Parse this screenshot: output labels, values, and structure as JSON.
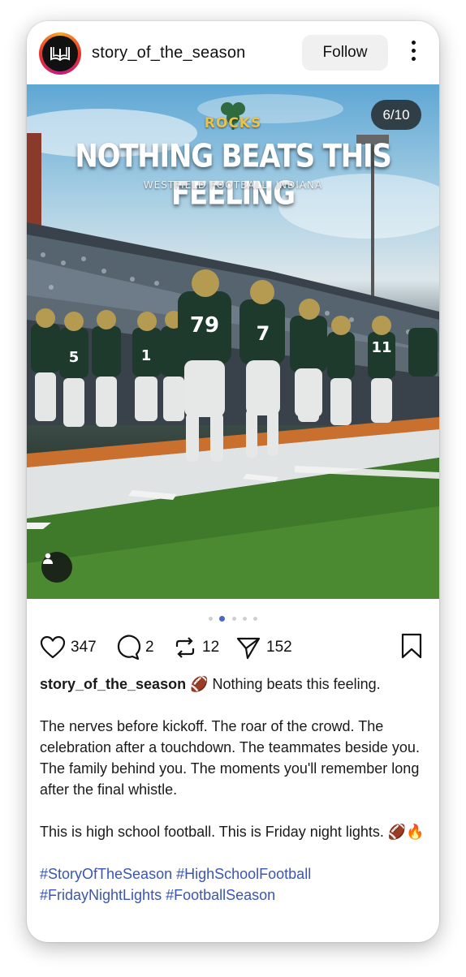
{
  "post": {
    "username": "story_of_the_season",
    "follow_label": "Follow",
    "image": {
      "counter": "6/10",
      "logo_text": "ROCKS",
      "headline": "NOTHING BEATS THIS FEELING",
      "subline": "WESTFIELD FOOTBALL, INDIANA",
      "jersey_numbers": [
        "79",
        "7",
        "1",
        "11",
        "5"
      ]
    },
    "carousel": {
      "total_dots": 5,
      "active_index": 1
    },
    "actions": {
      "likes": "347",
      "comments": "2",
      "reposts": "12",
      "shares": "152"
    },
    "caption": {
      "username": "story_of_the_season",
      "first_line": "🏈 Nothing beats this feeling.",
      "paragraph2": "The nerves before kickoff. The roar of the crowd. The celebration after a touchdown. The teammates beside you. The family behind you. The moments you'll remember long after the final whistle.",
      "paragraph3": "This is high school football. This is Friday night lights. 🏈🔥",
      "hashtags": "#StoryOfTheSeason #HighSchoolFootball #FridayNightLights #FootballSeason"
    }
  },
  "colors": {
    "accent_link": "#3a55b4",
    "carousel_active": "#4a67c8",
    "jersey_green": "#1d3a2c",
    "logo_gold": "#e8c24a"
  },
  "icons": [
    "book-logo-icon",
    "more-vertical-icon",
    "user-tag-icon",
    "heart-icon",
    "comment-icon",
    "repost-icon",
    "send-icon",
    "bookmark-icon",
    "shamrock-icon"
  ]
}
